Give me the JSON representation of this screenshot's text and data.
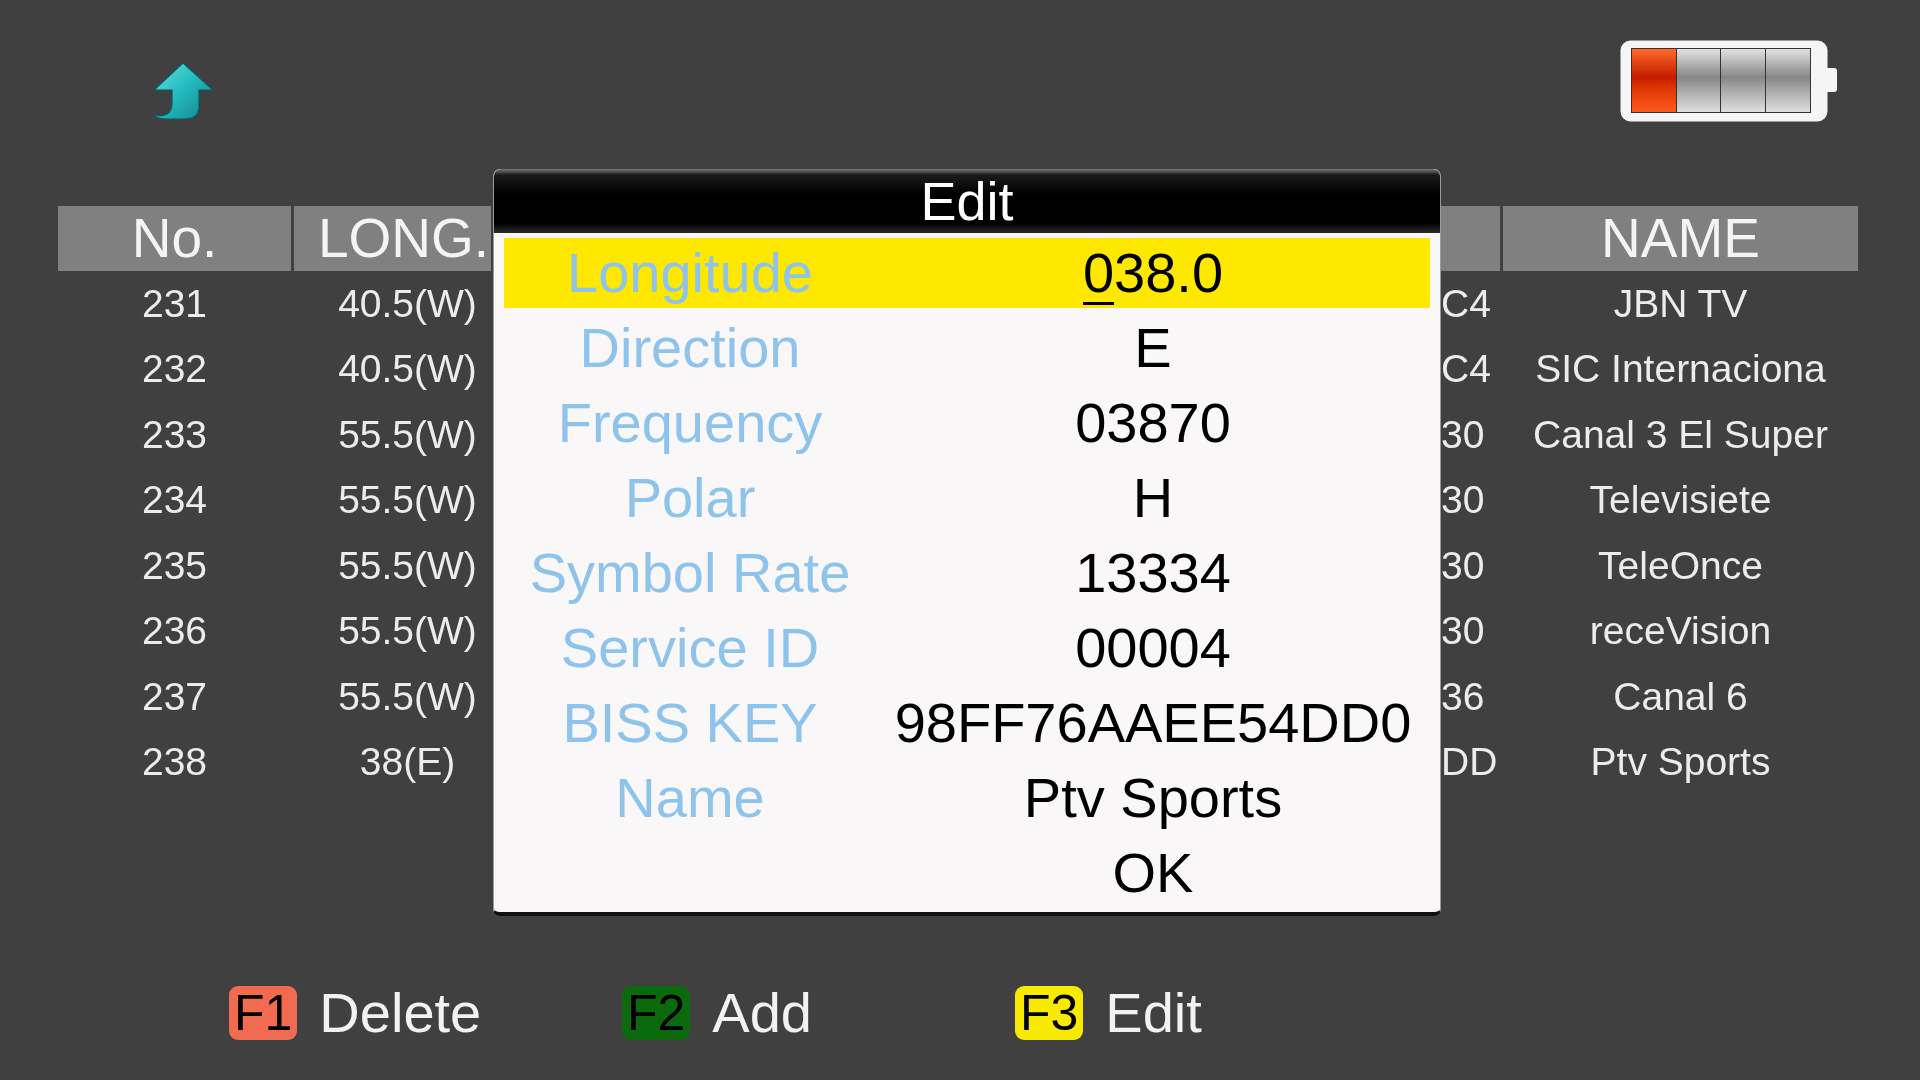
{
  "table": {
    "headers": [
      "No.",
      "LONG.",
      "NAME"
    ],
    "rows": [
      {
        "no": "231",
        "long": "40.5(W)",
        "column_3": "C4",
        "name": "JBN TV"
      },
      {
        "no": "232",
        "long": "40.5(W)",
        "column_3": "C4",
        "name": "SIC Internaciona"
      },
      {
        "no": "233",
        "long": "55.5(W)",
        "column_3": "30",
        "name": "Canal 3 El Super"
      },
      {
        "no": "234",
        "long": "55.5(W)",
        "column_3": "30",
        "name": "Televisiete"
      },
      {
        "no": "235",
        "long": "55.5(W)",
        "column_3": "30",
        "name": "TeleOnce"
      },
      {
        "no": "236",
        "long": "55.5(W)",
        "column_3": "30",
        "name": "receVision"
      },
      {
        "no": "237",
        "long": "55.5(W)",
        "column_3": "36",
        "name": "Canal 6"
      },
      {
        "no": "238",
        "long": "38(E)",
        "column_3": "DD",
        "name": "Ptv Sports"
      }
    ]
  },
  "dialog": {
    "title": "Edit",
    "items": [
      {
        "kind": "field",
        "label": "Longitude",
        "value": "038.0",
        "selected": true
      },
      {
        "kind": "field",
        "label": "Direction",
        "value": "E",
        "selected": false
      },
      {
        "kind": "field",
        "label": "Frequency",
        "value": "03870",
        "selected": false
      },
      {
        "kind": "field",
        "label": "Polar",
        "value": "H",
        "selected": false
      },
      {
        "kind": "field",
        "label": "Symbol Rate",
        "value": "13334",
        "selected": false
      },
      {
        "kind": "field",
        "label": "Service ID",
        "value": "00004",
        "selected": false
      },
      {
        "kind": "field",
        "label": "BISS KEY",
        "value": "98FF76AAEE54DD0",
        "selected": false
      },
      {
        "kind": "field",
        "label": "Name",
        "value": "Ptv Sports",
        "selected": false
      },
      {
        "kind": "button",
        "label": "OK",
        "selected": false
      }
    ]
  },
  "function_keys": [
    {
      "key": "F1",
      "label": "Delete",
      "color": "#f26a50"
    },
    {
      "key": "F2",
      "label": "Add",
      "color": "#0b6a0b"
    },
    {
      "key": "F3",
      "label": "Edit",
      "color": "#f7ea00"
    }
  ]
}
